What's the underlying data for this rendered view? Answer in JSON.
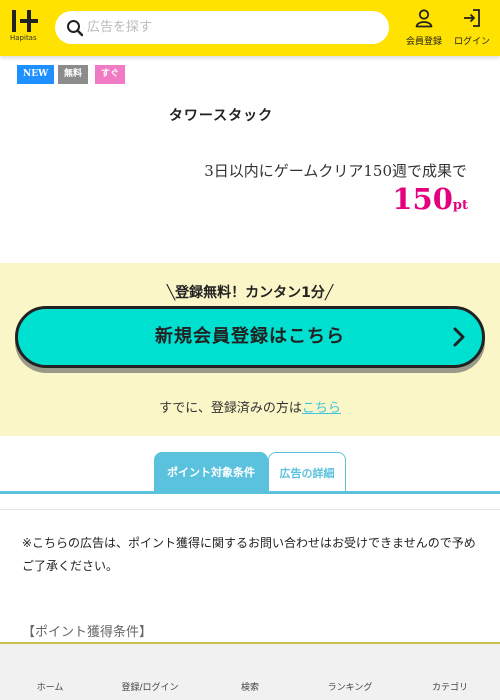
{
  "header": {
    "logo_text": "Hapitas",
    "search_placeholder": "広告を探す",
    "register_label": "会員登録",
    "login_label": "ログイン"
  },
  "tags": {
    "new": "NEW",
    "free": "無料",
    "soon": "すぐ"
  },
  "ad": {
    "title": "タワースタック",
    "condition": "3日以内にゲームクリア150週で成果で",
    "points_value": "150",
    "points_unit": "pt"
  },
  "register": {
    "catch": "╲登録無料！カンタン1分╱",
    "button_label": "新規会員登録はこちら",
    "login_prefix": "すでに、登録済みの方は",
    "login_link": "こちら"
  },
  "tabs": [
    {
      "label": "ポイント対象条件",
      "active": true
    },
    {
      "label": "広告の詳細",
      "active": false
    }
  ],
  "notice": "※こちらの広告は、ポイント獲得に関するお問い合わせはお受けできませんので予めご了承ください。",
  "condition_heading": "【ポイント獲得条件】",
  "bottom_nav": [
    "ホーム",
    "登録/ログイン",
    "検索",
    "ランキング",
    "カテゴリ"
  ],
  "colors": {
    "header_bg": "#ffe200",
    "accent_pink": "#e5007f",
    "button_bg": "#00e0d0",
    "tab_blue": "#5bc2dd",
    "panel_bg": "#fbf6c8"
  }
}
